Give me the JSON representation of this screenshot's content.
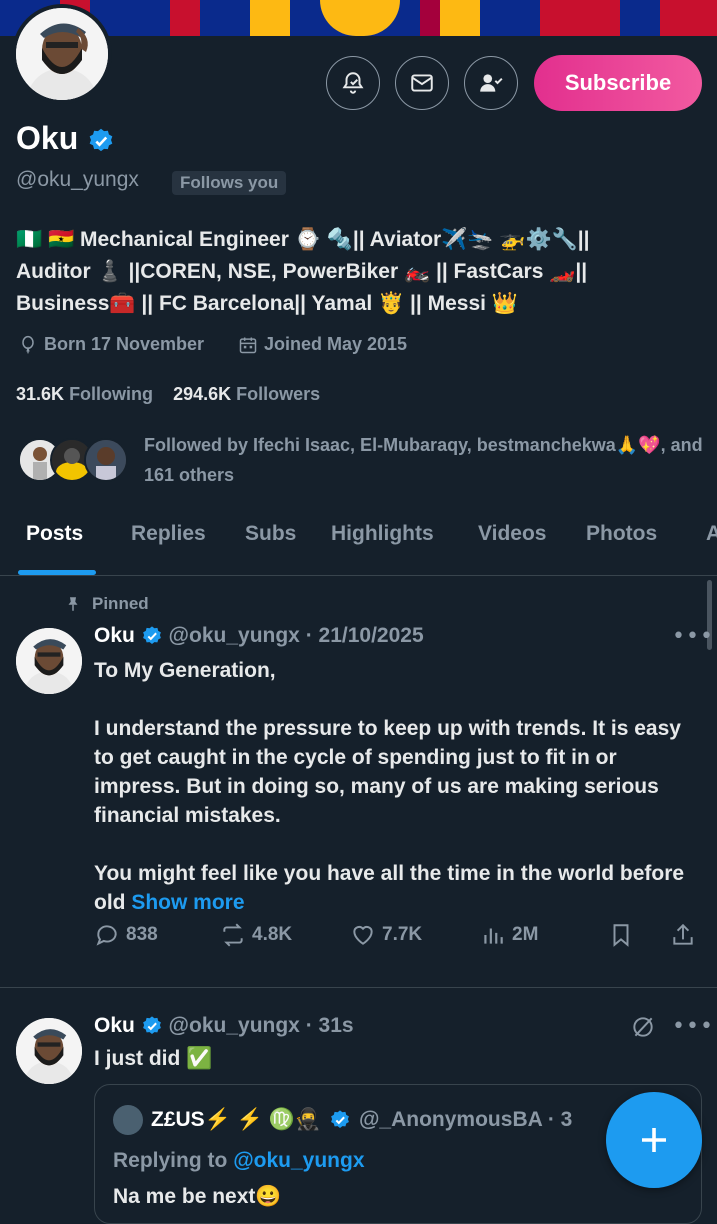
{
  "profile": {
    "name": "Oku",
    "handle": "@oku_yungx",
    "follows_you": "Follows you",
    "subscribe_label": "Subscribe",
    "bio_line1": "🇳🇬 🇬🇭 Mechanical Engineer ⌚ 🔩|| Aviator✈️🛬 🚁⚙️🔧||",
    "bio_line2": "Auditor ♟️ ||COREN, NSE, PowerBiker 🏍️ || FastCars 🏎️||",
    "bio_line3": "Business🧰 || FC Barcelona|| Yamal 🤴 || Messi 👑",
    "born": "Born 17 November",
    "joined": "Joined May 2015",
    "following_count": "31.6K",
    "following_label": "Following",
    "followers_count": "294.6K",
    "followers_label": "Followers",
    "followed_by": "Followed by Ifechi Isaac, El-Mubaraqy, bestmanchekwa🙏💖, and 161 others"
  },
  "tabs": [
    "Posts",
    "Replies",
    "Subs",
    "Highlights",
    "Videos",
    "Photos",
    "A"
  ],
  "pinned_label": "Pinned",
  "post1": {
    "name": "Oku",
    "meta": "@oku_yungx · 21/10/2025",
    "line1": "To My Generation,",
    "para2": "I understand the pressure to keep up with trends. It is easy to get caught in the cycle of spending just to fit in or impress. But in doing so, many of us are making serious financial mistakes.",
    "para3": "You might feel like you have all the time in the world before old",
    "show_more": "Show more",
    "replies": "838",
    "reposts": "4.8K",
    "likes": "7.7K",
    "views": "2M"
  },
  "post2": {
    "name": "Oku",
    "meta": "@oku_yungx · 31s",
    "text": "I just did ✅",
    "quote_name": "Z£US⚡ ⚡ ♍🥷",
    "quote_meta": "@_AnonymousBA · 3",
    "quote_replying": "Replying to",
    "quote_replying_handle": "@oku_yungx",
    "quote_text": "Na me be next😀"
  },
  "colors": {
    "background": "#15202b",
    "accent": "#1d9bf0",
    "subscribe": "#e22f8e",
    "secondary_text": "#8b98a5"
  }
}
